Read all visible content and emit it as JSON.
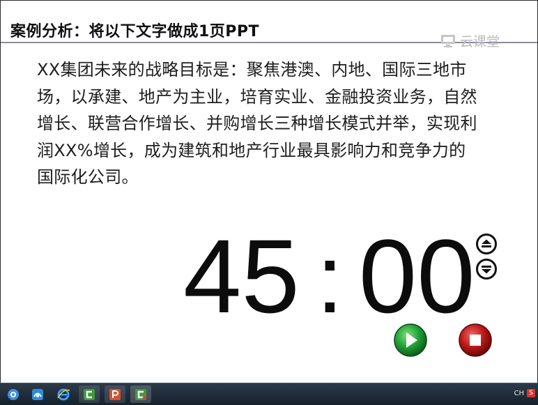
{
  "slide": {
    "title": "案例分析：将以下文字做成1页PPT",
    "brand": "云课堂",
    "body_lines": [
      "XX集团未来的战略目标是：聚焦港澳、内地、国际三地市",
      "场，以承建、地产为主业，培育实业、金融投资业务，自然",
      "增长、联营合作增长、并购增长三种增长模式并举，实现利",
      "润XX%增长，成为建筑和地产行业最具影响力和竞争力的",
      "国际化公司。"
    ]
  },
  "timer": {
    "minutes": "45",
    "separator": ":",
    "seconds": "00"
  },
  "controls": {
    "up_icon": "double-up-arrow-icon",
    "down_icon": "double-down-arrow-icon",
    "play_icon": "play-icon",
    "stop_icon": "stop-icon",
    "play_color": "#22a33a",
    "stop_color": "#c01818"
  },
  "taskbar": {
    "apps": [
      "360-browser-icon",
      "browser-icon",
      "internet-explorer-icon",
      "camtasia-icon",
      "powerpoint-icon",
      "camtasia-recorder-icon"
    ],
    "tray_text": "CH"
  },
  "colors": {
    "title_rule": "#8a8aa0",
    "brand": "#b8b8b8",
    "taskbar": "#1f2b38"
  }
}
